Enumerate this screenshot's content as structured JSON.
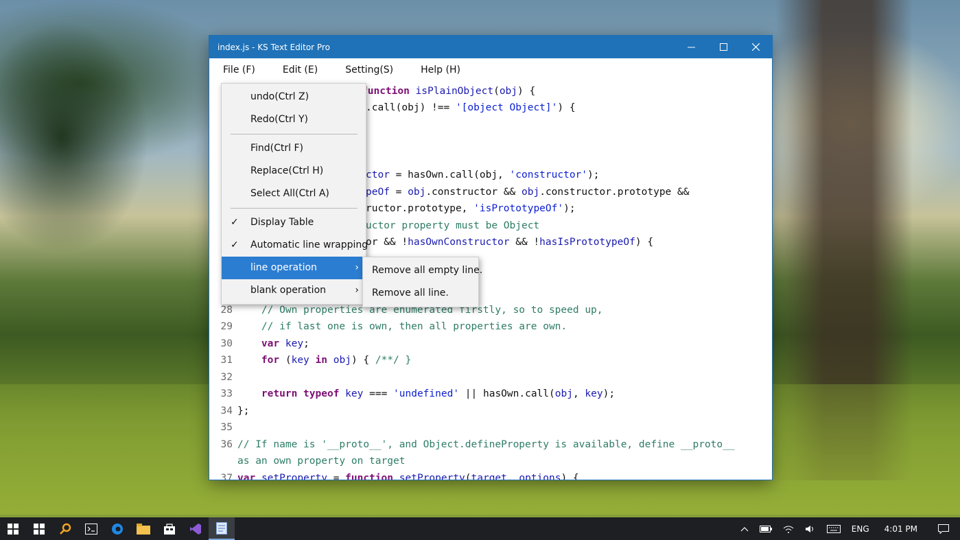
{
  "window": {
    "title": "index.js - KS Text Editor Pro",
    "minimize": "—",
    "maximize": "☐",
    "close": "✕"
  },
  "menubar": {
    "file": "File (F)",
    "edit": "Edit (E)",
    "setting": "Setting(S)",
    "help": "Help (H)"
  },
  "edit_menu": {
    "undo": "undo(Ctrl Z)",
    "redo": "Redo(Ctrl Y)",
    "find": "Find(Ctrl F)",
    "replace": "Replace(Ctrl H)",
    "select_all": "Select All(Ctrl A)",
    "display_table": "Display Table",
    "auto_wrap": "Automatic line wrapping",
    "line_operation": "line operation",
    "blank_operation": "blank operation",
    "checkmark": "✓",
    "submenu_arrow": "›"
  },
  "line_submenu": {
    "remove_empty": "Remove all empty line.",
    "remove_all": "Remove all line."
  },
  "code": {
    "l1": "function isPlainObject(obj) {",
    "l2a": ".call(obj) !== ",
    "l2b": "'[object Object]'",
    "l2c": ") {",
    "l5a": "ctor",
    "l5b": " = hasOwn.call(obj, ",
    "l5c": "'constructor'",
    "l5d": ");",
    "l6a": "peOf",
    "l6b": " = ",
    "l6c": "obj",
    "l6d": ".constructor && ",
    "l6e": "obj",
    "l6f": ".constructor.prototype &&",
    "l7a": "ructor.prototype, ",
    "l7b": "'isPrototypeOf'",
    "l7c": ");",
    "l8": "uctor property must be Object",
    "l9a": "or && !",
    "l9b": "hasOwnConstructor",
    "l9c": " && !",
    "l9d": "hasIsPrototypeOf",
    "l9e": ") {",
    "n28": "28",
    "c28": "    // Own properties are enumerated firstly, so to speed up,",
    "n29": "29",
    "c29": "    // if last one is own, then all properties are own.",
    "n30": "30",
    "n31": "31",
    "n32": "32",
    "n33": "33",
    "n34": "34",
    "c34": "};",
    "n35": "35",
    "n36": "36",
    "c36": "// If name is '__proto__', and Object.defineProperty is available, define __proto__",
    "c36b": "as an own property on target",
    "n37": "37",
    "kw_var": "var",
    "kw_for": "for",
    "kw_in": "in",
    "kw_return": "return",
    "kw_typeof": "typeof",
    "kw_function": "function",
    "id_key": "key",
    "id_obj": "obj",
    "str_undefined": "'undefined'",
    "c31_tail": " /**/ }",
    "c33_mid": " || hasOwn.call(",
    "c33_tail": ");",
    "c37_id": "setProperty",
    "c37_fn": "setProperty",
    "c37_args": "target, options",
    "c37_tail": ") {"
  },
  "taskbar": {
    "lang": "ENG",
    "time": "4:01 PM"
  }
}
